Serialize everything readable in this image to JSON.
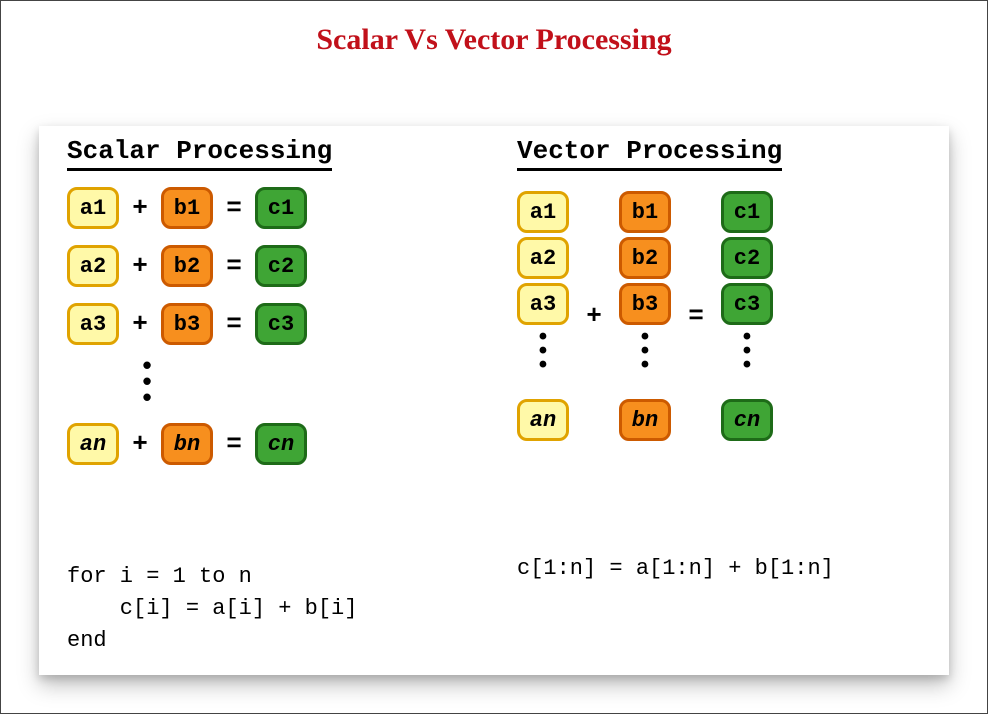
{
  "title": "Scalar Vs Vector Processing",
  "colors": {
    "a_bg": "#fff9a8",
    "a_border": "#e0a300",
    "b_bg": "#f78f1e",
    "b_border": "#cc5a00",
    "c_bg": "#3fa535",
    "c_border": "#1e6b18",
    "title_color": "#c1101a"
  },
  "scalar": {
    "heading": "Scalar Processing",
    "rows": [
      {
        "a": "a1",
        "op1": "+",
        "b": "b1",
        "op2": "=",
        "c": "c1"
      },
      {
        "a": "a2",
        "op1": "+",
        "b": "b2",
        "op2": "=",
        "c": "c2"
      },
      {
        "a": "a3",
        "op1": "+",
        "b": "b3",
        "op2": "=",
        "c": "c3"
      }
    ],
    "ellipsis": "•••",
    "last": {
      "a": "an",
      "op1": "+",
      "b": "bn",
      "op2": "=",
      "c": "cn"
    },
    "code_l1": "for i = 1 to n",
    "code_l2": "    c[i] = a[i] + b[i]",
    "code_l3": "end"
  },
  "vector": {
    "heading": "Vector Processing",
    "a": [
      "a1",
      "a2",
      "a3"
    ],
    "a_last": "an",
    "b": [
      "b1",
      "b2",
      "b3"
    ],
    "b_last": "bn",
    "c": [
      "c1",
      "c2",
      "c3"
    ],
    "c_last": "cn",
    "op1": "+",
    "op2": "=",
    "ellipsis": "•••",
    "code": "c[1:n] = a[1:n] + b[1:n]"
  }
}
